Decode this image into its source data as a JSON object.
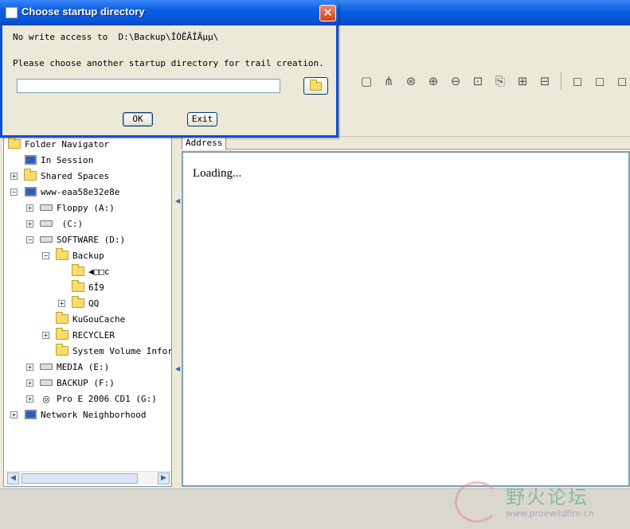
{
  "dialog": {
    "title": "Choose startup directory",
    "message_line1": "No write access to  D:\\Backup\\ÎÒÊÃÎÃµµ\\",
    "message_line2": "Please choose another startup directory for trail creation.",
    "directory_value": "",
    "ok_label": "OK",
    "exit_label": "Exit",
    "close_glyph": "✕"
  },
  "navigator": {
    "items": [
      {
        "label": "Folder Navigator",
        "icon": "folder-navigator-icon"
      },
      {
        "label": "In Session",
        "icon": "in-session-icon"
      },
      {
        "label": "Shared Spaces",
        "icon": "shared-spaces-icon"
      },
      {
        "label": "www-eaa58e32e8e",
        "icon": "computer-icon"
      },
      {
        "label": "Floppy  (A:)",
        "icon": "floppy-drive-icon"
      },
      {
        "label": " (C:)",
        "icon": "drive-icon"
      },
      {
        "label": "SOFTWARE  (D:)",
        "icon": "drive-icon"
      },
      {
        "label": "Backup",
        "icon": "folder-icon"
      },
      {
        "label": "◀□□c",
        "icon": "folder-icon"
      },
      {
        "label": "6Î9",
        "icon": "folder-icon"
      },
      {
        "label": "QQ",
        "icon": "folder-icon"
      },
      {
        "label": "KuGouCache",
        "icon": "folder-icon"
      },
      {
        "label": "RECYCLER",
        "icon": "folder-icon"
      },
      {
        "label": "System Volume Inform",
        "icon": "folder-icon"
      },
      {
        "label": "MEDIA  (E:)",
        "icon": "drive-icon"
      },
      {
        "label": "BACKUP  (F:)",
        "icon": "drive-icon"
      },
      {
        "label": "Pro E 2006 CD1  (G:)",
        "icon": "cd-drive-icon"
      },
      {
        "label": "Network Neighborhood",
        "icon": "network-icon"
      }
    ]
  },
  "browser": {
    "address_label": "Address",
    "content_text": "Loading..."
  },
  "watermark": {
    "text": "野火论坛",
    "url": "www.proewildfire.cn"
  }
}
